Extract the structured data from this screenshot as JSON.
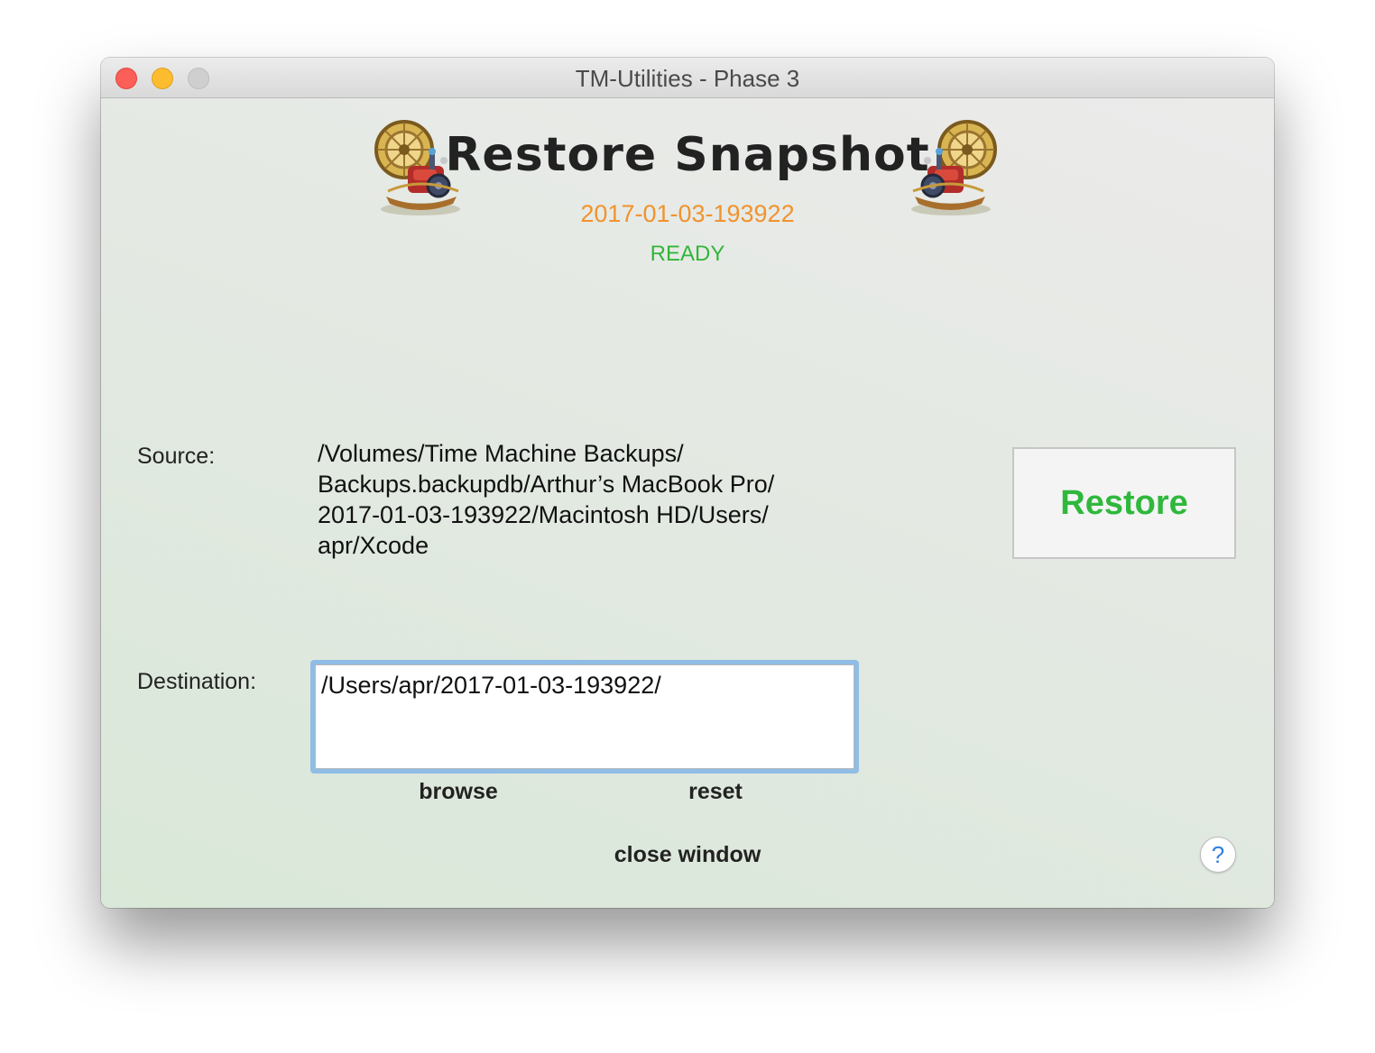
{
  "window": {
    "title": "TM-Utilities - Phase 3"
  },
  "header": {
    "title": "Restore Snapshot",
    "snapshot": "2017-01-03-193922",
    "status": "READY",
    "icon": "time-machine-icon"
  },
  "source": {
    "label": "Source:",
    "path_lines": [
      "/Volumes/Time Machine Backups/",
      "Backups.backupdb/Arthur’s MacBook Pro/",
      "2017-01-03-193922/Macintosh HD/Users/",
      "apr/Xcode"
    ]
  },
  "destination": {
    "label": "Destination:",
    "value": "/Users/apr/2017-01-03-193922/",
    "browse_label": "browse",
    "reset_label": "reset"
  },
  "actions": {
    "restore_label": "Restore",
    "close_label": "close window",
    "help_label": "?"
  },
  "colors": {
    "snapshot": "#f0932e",
    "status": "#33b53a",
    "restore": "#2fb83c",
    "focus_ring": "#8fbde5"
  }
}
